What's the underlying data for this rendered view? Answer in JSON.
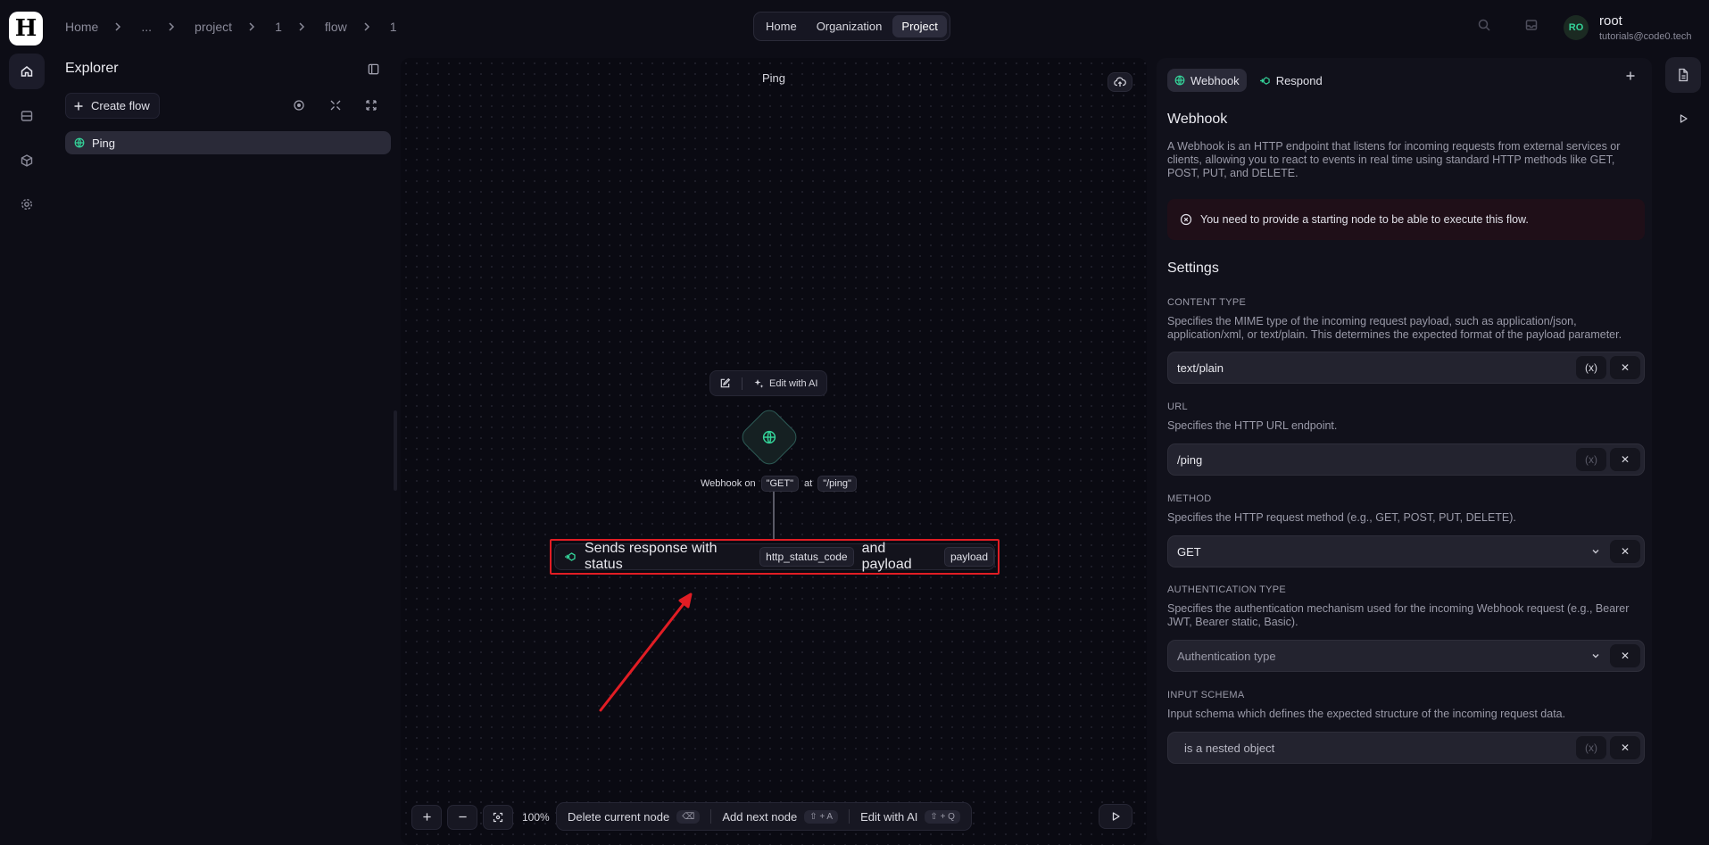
{
  "app": {
    "logo_letter": "H"
  },
  "breadcrumb": [
    "Home",
    "...",
    "project",
    "1",
    "flow",
    "1"
  ],
  "topnav": {
    "items": [
      "Home",
      "Organization",
      "Project"
    ],
    "active": "Project"
  },
  "user": {
    "initials": "RO",
    "name": "root",
    "email": "tutorials@code0.tech"
  },
  "rail": {
    "icons": [
      "home-icon",
      "database-icon",
      "cube-icon",
      "settings-icon"
    ]
  },
  "explorer": {
    "title": "Explorer",
    "create_label": "Create flow",
    "flows": [
      {
        "name": "Ping",
        "icon": "globe-icon"
      }
    ]
  },
  "canvas": {
    "title": "Ping",
    "toolbar": {
      "edit_ai_label": "Edit with AI"
    },
    "webhook_node": {
      "caption_prefix": "Webhook on",
      "method": "\"GET\"",
      "connector": "at",
      "path": "\"/ping\""
    },
    "respond_node": {
      "text_1": "Sends response with status",
      "chip_1": "http_status_code",
      "text_2": "and payload",
      "chip_2": "payload"
    },
    "zoom_level": "100%",
    "actions": [
      {
        "label": "Delete current node",
        "shortcut": "⌫"
      },
      {
        "label": "Add next node",
        "shortcut": "⇧ + A"
      },
      {
        "label": "Edit with AI",
        "shortcut": "⇧ + Q"
      }
    ],
    "annotation_color": "#e11d24"
  },
  "panel": {
    "tabs": [
      {
        "label": "Webhook",
        "icon": "globe-icon"
      },
      {
        "label": "Respond",
        "icon": "respond-icon"
      }
    ],
    "title": "Webhook",
    "description": "A Webhook is an HTTP endpoint that listens for incoming requests from external services or clients, allowing you to react to events in real time using standard HTTP methods like GET, POST, PUT, and DELETE.",
    "alert": "You need to provide a starting node to be able to execute this flow.",
    "settings_title": "Settings",
    "fields": {
      "content_type": {
        "label": "CONTENT TYPE",
        "desc": "Specifies the MIME type of the incoming request payload, such as application/json, application/xml, or text/plain. This determines the expected format of the payload parameter.",
        "value": "text/plain"
      },
      "url": {
        "label": "URL",
        "desc": "Specifies the HTTP URL endpoint.",
        "value": "/ping"
      },
      "method": {
        "label": "METHOD",
        "desc": "Specifies the HTTP request method (e.g., GET, POST, PUT, DELETE).",
        "value": "GET"
      },
      "auth": {
        "label": "AUTHENTICATION TYPE",
        "desc": "Specifies the authentication mechanism used for the incoming Webhook request (e.g., Bearer JWT, Bearer static, Basic).",
        "placeholder": "Authentication type"
      },
      "schema": {
        "label": "INPUT SCHEMA",
        "desc": "Input schema which defines the expected structure of the incoming request data.",
        "value": "is a nested object"
      }
    },
    "variable_glyph": "(x)",
    "clear_glyph": "✕"
  }
}
